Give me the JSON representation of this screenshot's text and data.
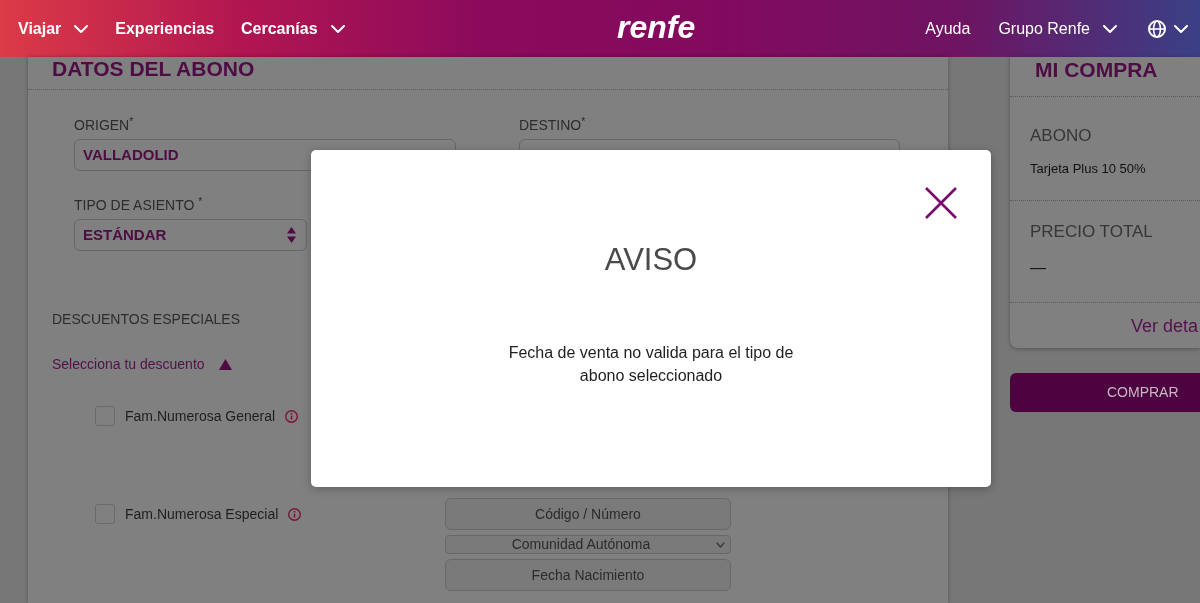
{
  "header": {
    "nav_left": [
      {
        "label": "Viajar",
        "has_menu": true
      },
      {
        "label": "Experiencias",
        "has_menu": false
      },
      {
        "label": "Cercanías",
        "has_menu": true
      }
    ],
    "logo": "renfe",
    "nav_right": [
      {
        "label": "Ayuda",
        "has_menu": false
      },
      {
        "label": "Grupo Renfe",
        "has_menu": true
      }
    ]
  },
  "form": {
    "title": "DATOS DEL ABONO",
    "fields": [
      {
        "label": "ORIGEN$^{*}$",
        "value": "VALLADOLID"
      },
      {
        "label": "DESTINO$^{*}$"
      }
    ],
    "seat": {
      "label": "TIPO DE ASIENTO $^{*}$",
      "value": "ESTÁNDAR"
    },
    "discounts": {
      "title": "DESCUENTOS ESPECIALES",
      "toggle": "Selecciona tu descuento",
      "expanded": true,
      "options": [
        {
          "label": "Fam.Numerosa General",
          "checked": false
        },
        {
          "label": "Fam.Numerosa Especial",
          "checked": false,
          "fields": [
            {
              "kind": "input",
              "placeholder": "Código / Número",
              "disabled": true
            },
            {
              "kind": "select",
              "placeholder": "Comunidad Autónoma",
              "disabled": true
            },
            {
              "kind": "input",
              "placeholder": "Fecha Nacimiento",
              "disabled": true
            }
          ]
        }
      ]
    }
  },
  "summary": {
    "title": "MI COMPRA",
    "sections": [
      {
        "heading": "ABONO",
        "value": "Tarjeta Plus 10 50%"
      },
      {
        "heading": "PRECIO TOTAL",
        "value": "—"
      }
    ],
    "details_link": "Ver deta",
    "buy_button": "COMPRAR"
  },
  "dialog": {
    "title": "AVISO",
    "message": "Fecha de venta no valida para el tipo de abono seleccionado"
  }
}
